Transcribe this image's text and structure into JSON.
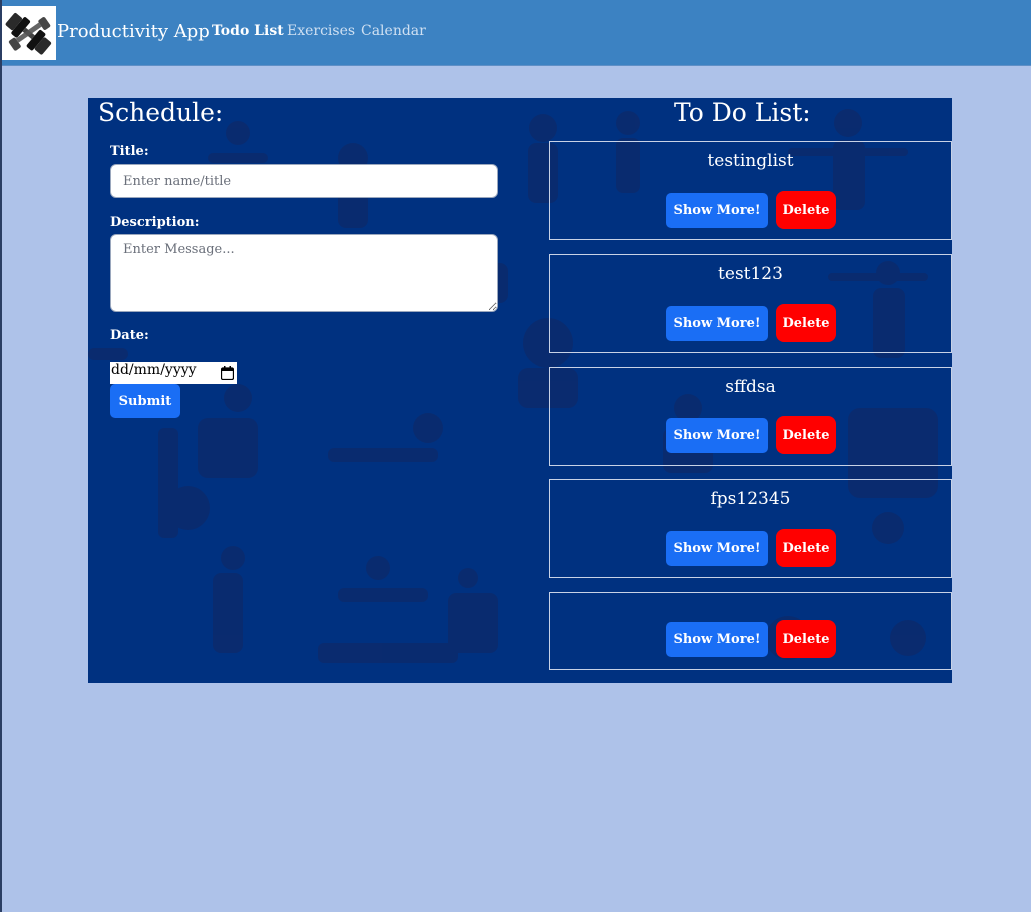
{
  "nav": {
    "brand": "Productivity App",
    "links": [
      "Todo List",
      "Exercises",
      "Calendar"
    ],
    "active": "Todo List"
  },
  "schedule": {
    "heading": "Schedule:",
    "title_label": "Title:",
    "title_placeholder": "Enter name/title",
    "description_label": "Description:",
    "description_placeholder": "Enter Message...",
    "date_label": "Date:",
    "date_placeholder": "dd/mm/yyyy",
    "submit_label": "Submit"
  },
  "todo": {
    "heading": "To Do List:",
    "show_more_label": "Show More!",
    "delete_label": "Delete",
    "items": [
      {
        "title": "testinglist"
      },
      {
        "title": "test123"
      },
      {
        "title": "sffdsa"
      },
      {
        "title": "fps12345"
      },
      {
        "title": ""
      }
    ]
  },
  "colors": {
    "page_bg": "#aec2e9",
    "navbar": "#3c82c2",
    "panel": "#003180",
    "primary_button": "#1a6ef5",
    "danger_button": "#ff0000"
  }
}
